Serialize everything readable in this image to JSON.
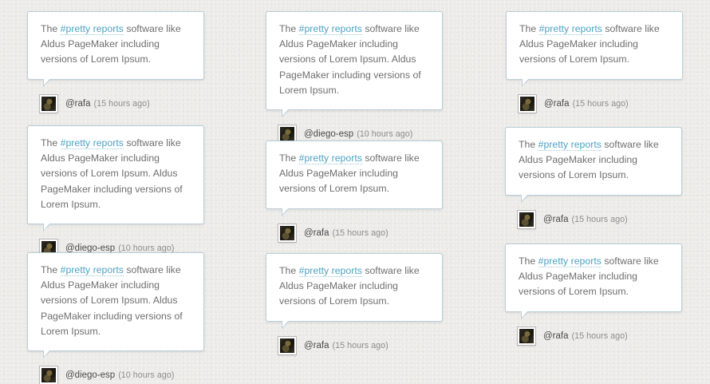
{
  "tweets": [
    {
      "text_before": "The ",
      "hashtag": "#pretty reports",
      "text_after": " software like Aldus PageMaker including versions of Lorem Ipsum.",
      "user": "@rafa",
      "time": "(15 hours ago)"
    },
    {
      "text_before": "The ",
      "hashtag": "#pretty reports",
      "text_after": " software like Aldus PageMaker including versions of Lorem Ipsum. Aldus PageMaker including versions of Lorem Ipsum.",
      "user": "@diego-esp",
      "time": "(10 hours ago)"
    },
    {
      "text_before": "The ",
      "hashtag": "#pretty reports",
      "text_after": " software like Aldus PageMaker including versions of Lorem Ipsum. Aldus PageMaker including versions of Lorem Ipsum.",
      "user": "@diego-esp",
      "time": "(10 hours ago)"
    },
    {
      "text_before": "The ",
      "hashtag": "#pretty reports",
      "text_after": " software like Aldus PageMaker including versions of Lorem Ipsum. Aldus PageMaker including versions of Lorem Ipsum.",
      "user": "@diego-esp",
      "time": "(10 hours ago)"
    },
    {
      "text_before": "The ",
      "hashtag": "#pretty reports",
      "text_after": " software like Aldus PageMaker including versions of Lorem Ipsum.",
      "user": "@rafa",
      "time": "(15 hours ago)"
    },
    {
      "text_before": "The ",
      "hashtag": "#pretty reports",
      "text_after": " software like Aldus PageMaker including versions of Lorem Ipsum.",
      "user": "@rafa",
      "time": "(15 hours ago)"
    },
    {
      "text_before": "The ",
      "hashtag": "#pretty reports",
      "text_after": " software like Aldus PageMaker including versions of Lorem Ipsum.",
      "user": "@rafa",
      "time": "(15 hours ago)"
    },
    {
      "text_before": "The ",
      "hashtag": "#pretty reports",
      "text_after": " software like Aldus PageMaker including versions of Lorem Ipsum.",
      "user": "@rafa",
      "time": "(15 hours ago)"
    },
    {
      "text_before": "The ",
      "hashtag": "#pretty reports",
      "text_after": " software like Aldus PageMaker including versions of Lorem Ipsum.",
      "user": "@rafa",
      "time": "(15 hours ago)"
    }
  ],
  "colors": {
    "hashtag": "#4ea3c3",
    "bubble_border": "#b9cdd8",
    "text": "#6f6f6f",
    "username": "#4a4a4a",
    "time": "#8e8e8e",
    "background": "#ecebe8"
  }
}
